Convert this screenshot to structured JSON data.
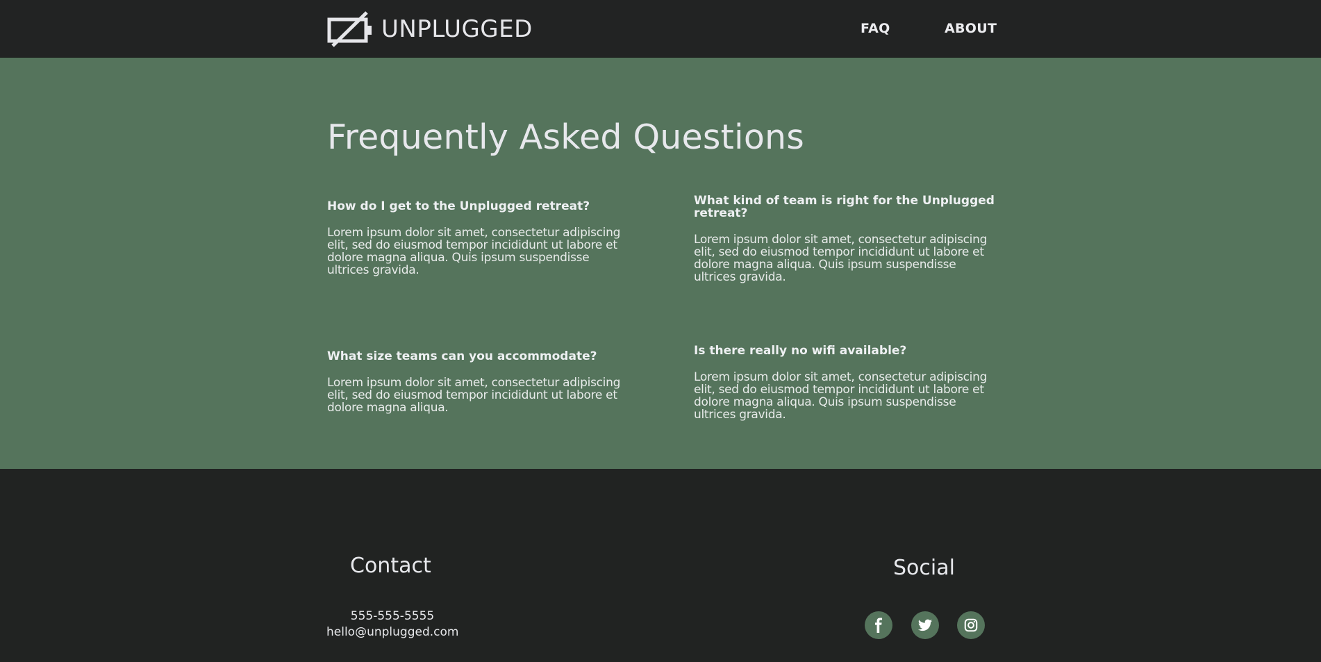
{
  "header": {
    "logo_text": "UNPLUGGED",
    "nav": [
      {
        "label": "FAQ"
      },
      {
        "label": "ABOUT"
      }
    ]
  },
  "main": {
    "title": "Frequently Asked Questions",
    "faqs": [
      {
        "question": "How do I get to the Unplugged retreat?",
        "answer": "Lorem ipsum dolor sit amet, consectetur adipiscing elit, sed do eiusmod tempor incididunt ut labore et dolore magna aliqua. Quis ipsum suspendisse ultrices gravida."
      },
      {
        "question": "What kind of team is right for the Unplugged retreat?",
        "answer": "Lorem ipsum dolor sit amet, consectetur adipiscing elit, sed do eiusmod tempor incididunt ut labore et dolore magna aliqua. Quis ipsum suspendisse ultrices gravida."
      },
      {
        "question": "What size teams can you accommodate?",
        "answer": "Lorem ipsum dolor sit amet, consectetur adipiscing elit, sed do eiusmod tempor incididunt ut labore et dolore magna aliqua."
      },
      {
        "question": "Is there really no wifi available?",
        "answer": "Lorem ipsum dolor sit amet, consectetur adipiscing elit, sed do eiusmod tempor incididunt ut labore et dolore magna aliqua. Quis ipsum suspendisse ultrices gravida."
      }
    ]
  },
  "footer": {
    "contact": {
      "title": "Contact",
      "phone": "555-555-5555",
      "email": "hello@unplugged.com"
    },
    "social": {
      "title": "Social",
      "icons": [
        "facebook-icon",
        "twitter-icon",
        "instagram-icon"
      ]
    }
  },
  "colors": {
    "header_bg": "#222323",
    "main_bg": "#55745c",
    "footer_bg": "#212322",
    "text_light": "#e7e8ec"
  }
}
